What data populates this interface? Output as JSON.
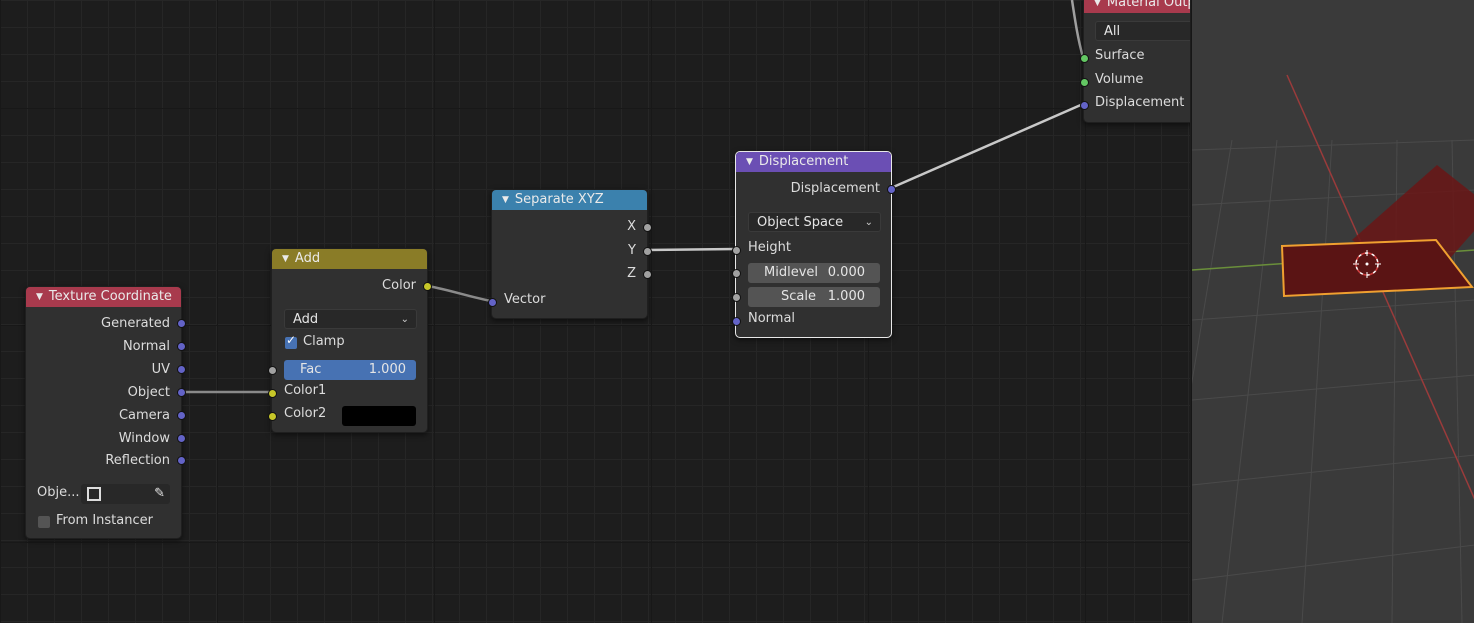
{
  "nodes": {
    "texture_coordinate": {
      "title": "Texture Coordinate",
      "outputs": [
        "Generated",
        "Normal",
        "UV",
        "Object",
        "Camera",
        "Window",
        "Reflection"
      ],
      "object_label": "Obje...",
      "from_instancer_label": "From Instancer",
      "from_instancer_checked": false,
      "header_color": "#a83a4d"
    },
    "add": {
      "title": "Add",
      "output": "Color",
      "blend_mode": "Add",
      "clamp_label": "Clamp",
      "clamp_checked": true,
      "fac_label": "Fac",
      "fac_value": "1.000",
      "color1_label": "Color1",
      "color2_label": "Color2",
      "color2_swatch": "#000000",
      "header_color": "#8a7c27"
    },
    "separate_xyz": {
      "title": "Separate XYZ",
      "outputs": [
        "X",
        "Y",
        "Z"
      ],
      "input": "Vector",
      "header_color": "#3b81ad"
    },
    "displacement": {
      "title": "Displacement",
      "output": "Displacement",
      "space": "Object Space",
      "height_label": "Height",
      "midlevel_label": "Midlevel",
      "midlevel_value": "0.000",
      "scale_label": "Scale",
      "scale_value": "1.000",
      "normal_label": "Normal",
      "header_color": "#6b4fb4"
    },
    "material_output": {
      "title": "Material Outp",
      "target": "All",
      "inputs": [
        "Surface",
        "Volume",
        "Displacement"
      ],
      "header_color": "#a83a4d"
    }
  },
  "colors": {
    "socket_vector": "#6363c7",
    "socket_color": "#c7c729",
    "socket_value": "#a1a1a1",
    "socket_shader": "#63c763",
    "selection_outline": "#f0a030",
    "checkbox_on": "#4772b3",
    "fac_slider": "#4772b3"
  }
}
